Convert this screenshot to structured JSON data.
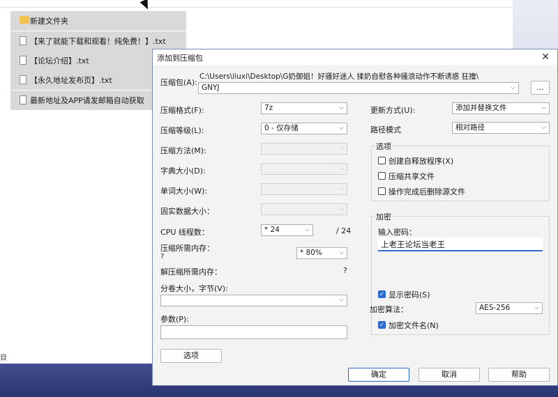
{
  "explorer": {
    "items": [
      {
        "name": "新建文件夹",
        "type": "folder"
      },
      {
        "name": "【来了就能下载和观看！纯免费！】.txt",
        "type": "file"
      },
      {
        "name": "【论坛介绍】.txt",
        "type": "file"
      },
      {
        "name": "【永久地址发布页】.txt",
        "type": "file"
      },
      {
        "name": "最新地址及APP请发邮箱自动获取",
        "type": "file"
      }
    ],
    "sidebar_fragment": "目"
  },
  "dialog": {
    "title": "添加到压缩包",
    "archive_label": "压缩包(A):",
    "archive_path": "C:\\Users\\liuxi\\Desktop\\G奶御姐！好骚好迷人 揉奶自慰各种骚浪动作不断诱惑 狂撸\\",
    "archive_name": "GNYJ",
    "browse_label": "...",
    "format_label": "压缩格式(F):",
    "format_value": "7z",
    "level_label": "压缩等级(L):",
    "level_value": "0 - 仅存储",
    "method_label": "压缩方法(M):",
    "dict_label": "字典大小(D):",
    "word_label": "单词大小(W):",
    "solid_label": "固实数据大小：",
    "cpu_label": "CPU 线程数：",
    "cpu_value": "* 24",
    "cpu_total": "/ 24",
    "mem_label": "压缩所需内存：",
    "mem_q": "?",
    "mem_value": "* 80%",
    "decomp_label": "解压缩所需内存：",
    "decomp_q": "?",
    "volume_label": "分卷大小，字节(V):",
    "params_label": "参数(P):",
    "options_btn": "选项",
    "update_label": "更新方式(U):",
    "update_value": "添加并替换文件",
    "path_label": "路径模式",
    "path_value": "相对路径",
    "options_group": "选项",
    "opt_sfx": "创建自释放程序(X)",
    "opt_shared": "压缩共享文件",
    "opt_delete": "操作完成后删除源文件",
    "encrypt_group": "加密",
    "pwd_label": "输入密码：",
    "pwd_value": "上老王论坛当老王",
    "show_pwd": "显示密码(S)",
    "enc_method_label": "加密算法：",
    "enc_method_value": "AES-256",
    "enc_names": "加密文件名(N)",
    "ok": "确定",
    "cancel": "取消",
    "help": "帮助",
    "close_glyph": "✕",
    "check_glyph": "✓"
  }
}
